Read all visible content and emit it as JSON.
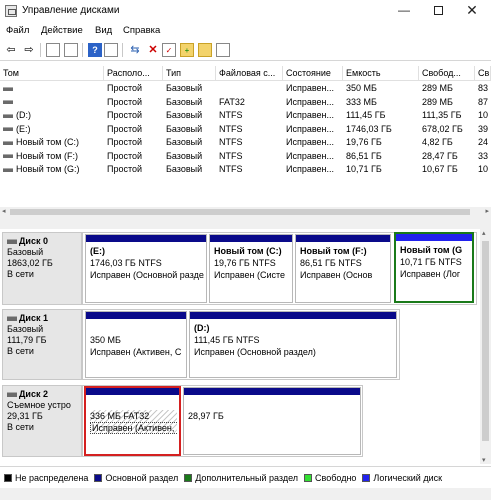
{
  "window": {
    "title": "Управление дисками",
    "controls": {
      "minimize": "—",
      "maximize": "",
      "close": "✕"
    }
  },
  "menu": [
    "Файл",
    "Действие",
    "Вид",
    "Справка"
  ],
  "toolbar": {
    "back": "⇦",
    "forward": "⇨",
    "help": "?"
  },
  "columns": [
    "Том",
    "Располо...",
    "Тип",
    "Файловая с...",
    "Состояние",
    "Емкость",
    "Свобод...",
    "Св"
  ],
  "volumes": [
    {
      "name": "",
      "location": "Простой",
      "type": "Базовый",
      "fs": "",
      "status": "Исправен...",
      "capacity": "350 МБ",
      "free": "289 МБ",
      "pct": "83"
    },
    {
      "name": "",
      "location": "Простой",
      "type": "Базовый",
      "fs": "FAT32",
      "status": "Исправен...",
      "capacity": "333 МБ",
      "free": "289 МБ",
      "pct": "87"
    },
    {
      "name": "(D:)",
      "location": "Простой",
      "type": "Базовый",
      "fs": "NTFS",
      "status": "Исправен...",
      "capacity": "111,45 ГБ",
      "free": "111,35 ГБ",
      "pct": "10"
    },
    {
      "name": "(E:)",
      "location": "Простой",
      "type": "Базовый",
      "fs": "NTFS",
      "status": "Исправен...",
      "capacity": "1746,03 ГБ",
      "free": "678,02 ГБ",
      "pct": "39"
    },
    {
      "name": "Новый том (C:)",
      "location": "Простой",
      "type": "Базовый",
      "fs": "NTFS",
      "status": "Исправен...",
      "capacity": "19,76 ГБ",
      "free": "4,82 ГБ",
      "pct": "24"
    },
    {
      "name": "Новый том (F:)",
      "location": "Простой",
      "type": "Базовый",
      "fs": "NTFS",
      "status": "Исправен...",
      "capacity": "86,51 ГБ",
      "free": "28,47 ГБ",
      "pct": "33"
    },
    {
      "name": "Новый том (G:)",
      "location": "Простой",
      "type": "Базовый",
      "fs": "NTFS",
      "status": "Исправен...",
      "capacity": "10,71 ГБ",
      "free": "10,67 ГБ",
      "pct": "10"
    }
  ],
  "disks": [
    {
      "name": "Диск 0",
      "kind": "Базовый",
      "size": "1863,02 ГБ",
      "state": "В сети",
      "partitions": [
        {
          "name": "(E:)",
          "size": "1746,03 ГБ NTFS",
          "status": "Исправен (Основной раздел)"
        },
        {
          "name": "Новый том (C:)",
          "size": "19,76 ГБ NTFS",
          "status": "Исправен (Систе"
        },
        {
          "name": "Новый том (F:)",
          "size": "86,51 ГБ NTFS",
          "status": "Исправен (Основ"
        },
        {
          "name": "Новый том (G",
          "size": "10,71 ГБ NTFS",
          "status": "Исправен (Лог"
        }
      ]
    },
    {
      "name": "Диск 1",
      "kind": "Базовый",
      "size": "111,79 ГБ",
      "state": "В сети",
      "partitions": [
        {
          "name": "",
          "size": "350 МБ",
          "status": "Исправен (Активен, С"
        },
        {
          "name": "(D:)",
          "size": "111,45 ГБ NTFS",
          "status": "Исправен (Основной раздел)"
        }
      ]
    },
    {
      "name": "Диск 2",
      "kind": "Съемное устро",
      "size": "29,31 ГБ",
      "state": "В сети",
      "partitions": [
        {
          "name": "",
          "size": "336 МБ FAT32",
          "status": "Исправен (Активен, Основной раздел)"
        },
        {
          "name": "",
          "size": "28,97 ГБ",
          "status": ""
        }
      ]
    }
  ],
  "legend": [
    {
      "label": "Не распределена",
      "color": "#000000"
    },
    {
      "label": "Основной раздел",
      "color": "#0a0a8a"
    },
    {
      "label": "Дополнительный раздел",
      "color": "#1a7a1a"
    },
    {
      "label": "Свободно",
      "color": "#33e033"
    },
    {
      "label": "Логический диск",
      "color": "#2222ee"
    }
  ]
}
